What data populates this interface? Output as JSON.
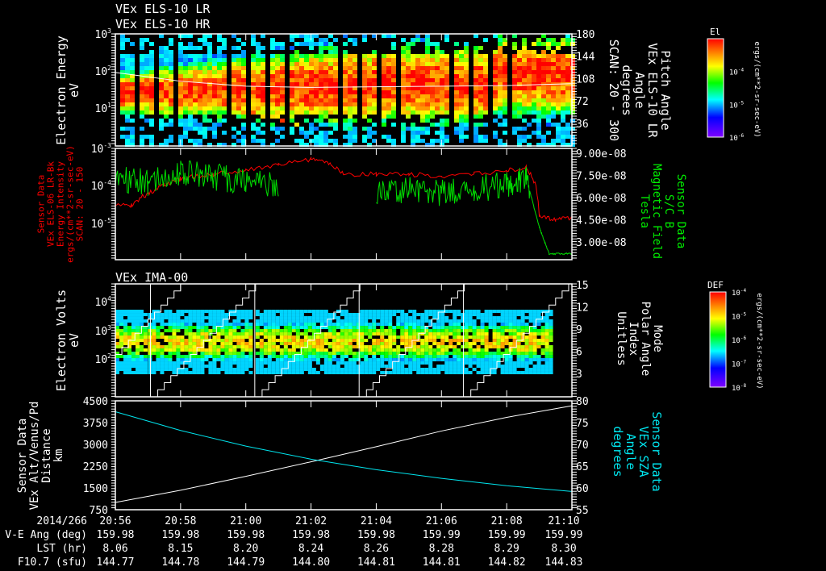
{
  "titles": {
    "panel1_line1": "VEx ELS-10 LR",
    "panel1_line2": "VEx ELS-10 HR",
    "panel3": "VEx IMA-00"
  },
  "colors": {
    "white": "#ffffff",
    "red": "#ff0000",
    "green": "#00dd00",
    "cyan": "#00e5ee"
  },
  "chart_data": [
    {
      "type": "heatmap",
      "title": "VEx ELS-10 LR / VEx ELS-10 HR",
      "ylabel": [
        "Electron Energy",
        "eV"
      ],
      "yscale": "log",
      "ylim": [
        1,
        1000
      ],
      "yticks": [
        {
          "e": "3"
        },
        {
          "e": "2"
        },
        {
          "e": "1"
        }
      ],
      "right_label": [
        "Pitch Angle",
        "VEx ELS-10 LR",
        "Angle",
        "degrees",
        "SCAN: 20 - 300"
      ],
      "right_ylim": [
        0,
        180
      ],
      "right_ticks": [
        "180",
        "144",
        "108",
        "72",
        "36"
      ],
      "colorbar": {
        "title": "El",
        "ticks": [
          {
            "e": "-4"
          },
          {
            "e": "-5"
          },
          {
            "e": "-6"
          }
        ],
        "unit": "ergs/(cm**2-sr-sec-eV)"
      },
      "overlay_pitch_angle": {
        "x_min": [
          0,
          2,
          4,
          6,
          8,
          10,
          12,
          14
        ],
        "y_deg": [
          118,
          104,
          96,
          94,
          95,
          96,
          97,
          100
        ]
      }
    },
    {
      "type": "line",
      "left_label": [
        "Sensor Data",
        "VEx ELS-06 LR-Bk",
        "Energy Intensity",
        "ergs/(cm**2-sr-sec-eV)",
        "SCAN: 20 - 150"
      ],
      "left_yscale": "log",
      "left_ylim": [
        1e-06,
        0.001
      ],
      "left_ticks": [
        {
          "e": "-3"
        },
        {
          "e": "-4"
        },
        {
          "e": "-5"
        }
      ],
      "right_label": [
        "Sensor Data",
        "S/C B",
        "Magnetic Field",
        "Tesla"
      ],
      "right_ylim": [
        1.8e-08,
        9.3e-08
      ],
      "right_ticks": [
        "9.00e-08",
        "7.50e-08",
        "6.00e-08",
        "4.50e-08",
        "3.00e-08"
      ],
      "series": [
        {
          "name": "Energy Intensity",
          "color": "red",
          "x_min": [
            0,
            0.5,
            1,
            1.5,
            2,
            3,
            4,
            5,
            6,
            6.5,
            7,
            8,
            9,
            10,
            11,
            12,
            12.6,
            13,
            13.5,
            14
          ],
          "y": [
            3e-05,
            3e-05,
            6e-05,
            0.0001,
            0.00015,
            0.0002,
            0.00025,
            0.00035,
            0.0005,
            0.0004,
            0.0002,
            0.0002,
            0.0002,
            0.00018,
            0.0002,
            0.00025,
            0.0003,
            1.5e-05,
            1.2e-05,
            1.3e-05
          ]
        },
        {
          "name": "Magnetic Field",
          "color": "green",
          "x_min": [
            0,
            1,
            2,
            3,
            4,
            5,
            5.2,
            7.6,
            8,
            9,
            10,
            11,
            12,
            12.6,
            13,
            13.3,
            14
          ],
          "y": [
            7.3e-08,
            7e-08,
            7.6e-08,
            7.4e-08,
            7e-08,
            6.8e-08,
            null,
            null,
            6.2e-08,
            6.6e-08,
            6.3e-08,
            6.6e-08,
            6.8e-08,
            7.3e-08,
            4e-08,
            2.2e-08,
            2.2e-08
          ]
        }
      ]
    },
    {
      "type": "heatmap",
      "title": "VEx IMA-00",
      "ylabel": [
        "Electron Volts",
        "eV"
      ],
      "yscale": "log",
      "ylim": [
        10,
        40000
      ],
      "yticks": [
        {
          "e": "4"
        },
        {
          "e": "3"
        },
        {
          "e": "2"
        }
      ],
      "right_label": [
        "Mode",
        "Polar Angle",
        "Index",
        "Unitless"
      ],
      "right_ylim": [
        0,
        15
      ],
      "right_ticks": [
        "15",
        "12",
        "9",
        "6",
        "3"
      ],
      "colorbar": {
        "title": "DEF",
        "ticks": [
          {
            "e": "-4"
          },
          {
            "e": "-5"
          },
          {
            "e": "-6"
          },
          {
            "e": "-7"
          },
          {
            "e": "-8"
          }
        ],
        "unit": "ergs/(cm**2-sr-sec-eV)"
      },
      "scan_starts_min": [
        -1.2,
        1.1,
        4.3,
        7.5,
        10.7,
        13.9
      ]
    },
    {
      "type": "line",
      "left_label": [
        "Sensor Data",
        "VEx Alt/Venus/Pd",
        "Distance",
        "km"
      ],
      "left_ylim": [
        750,
        4500
      ],
      "left_ticks": [
        "4500",
        "3750",
        "3000",
        "2250",
        "1500",
        "750"
      ],
      "right_label": [
        "Sensor Data",
        "VEx SZA",
        "Angle",
        "degrees"
      ],
      "right_ylim": [
        55,
        80
      ],
      "right_ticks": [
        "80",
        "75",
        "70",
        "65",
        "60",
        "55"
      ],
      "series": [
        {
          "name": "Altitude",
          "color": "white",
          "x_min": [
            0,
            2,
            4,
            6,
            8,
            10,
            12,
            14
          ],
          "y": [
            1000,
            1420,
            1900,
            2400,
            2920,
            3460,
            3930,
            4330
          ]
        },
        {
          "name": "SZA",
          "color": "cyan",
          "x_min": [
            0,
            2,
            4,
            6,
            8,
            10,
            12,
            14
          ],
          "y": [
            77.5,
            73.2,
            69.6,
            66.6,
            64.2,
            62.2,
            60.5,
            59.2
          ]
        }
      ]
    }
  ],
  "xaxis": {
    "row_labels": [
      "2014/266",
      "V-E Ang (deg)",
      "LST (hr)",
      "F10.7 (sfu)"
    ],
    "times": [
      "20:56",
      "20:58",
      "21:00",
      "21:02",
      "21:04",
      "21:06",
      "21:08",
      "21:10"
    ],
    "ve_ang": [
      "159.98",
      "159.98",
      "159.98",
      "159.98",
      "159.98",
      "159.99",
      "159.99",
      "159.99"
    ],
    "lst": [
      "8.06",
      "8.15",
      "8.20",
      "8.24",
      "8.26",
      "8.28",
      "8.29",
      "8.30"
    ],
    "f107": [
      "144.77",
      "144.78",
      "144.79",
      "144.80",
      "144.81",
      "144.81",
      "144.82",
      "144.83"
    ]
  }
}
